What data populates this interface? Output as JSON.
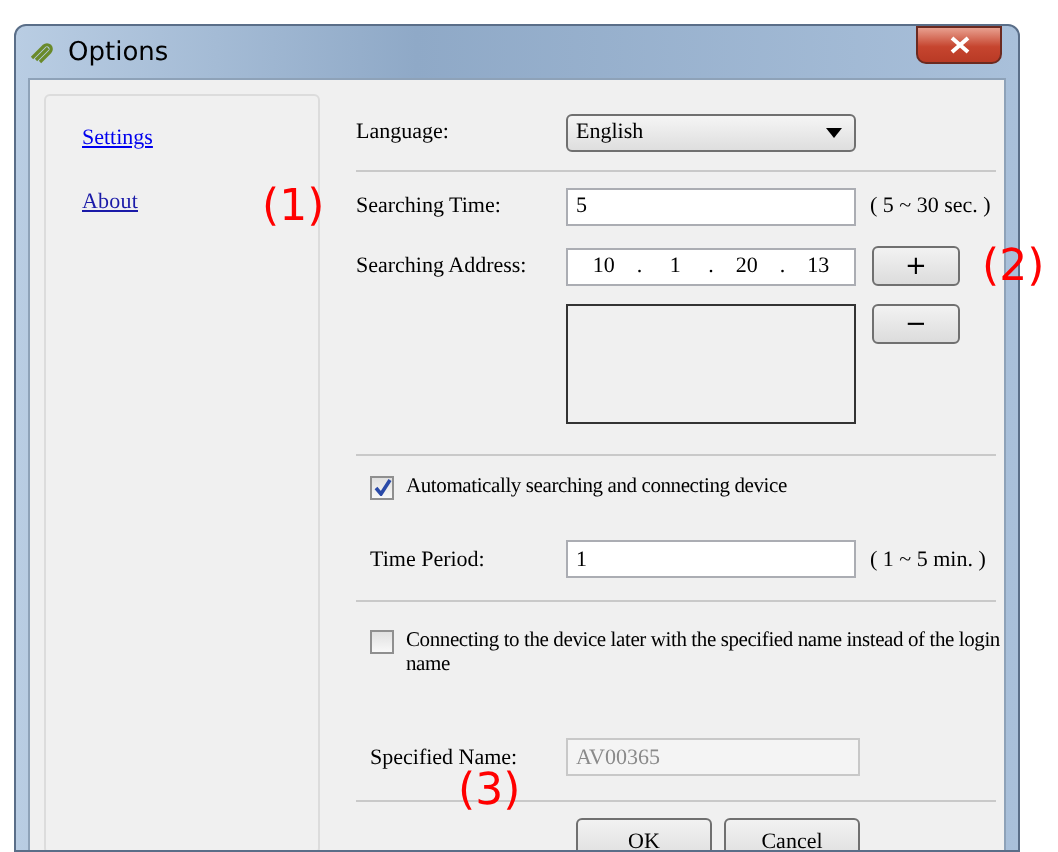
{
  "window": {
    "title": "Options"
  },
  "sidebar": {
    "items": [
      {
        "label": "Settings",
        "selected": true
      },
      {
        "label": "About",
        "selected": false
      }
    ]
  },
  "language": {
    "label": "Language:",
    "value": "English"
  },
  "searching_time": {
    "label": "Searching Time:",
    "value": "5",
    "hint": "( 5 ~ 30 sec. )"
  },
  "searching_address": {
    "label": "Searching Address:",
    "octets": [
      "10",
      "1",
      "20",
      "13"
    ],
    "separator": ".",
    "add_button": "+",
    "remove_button": "−"
  },
  "auto_search": {
    "label": "Automatically searching and connecting device",
    "checked": true
  },
  "time_period": {
    "label": "Time Period:",
    "value": "1",
    "hint": "( 1 ~ 5 min. )"
  },
  "specified_name_option": {
    "label": "Connecting to the device later with the specified name instead of the login name",
    "checked": false
  },
  "specified_name": {
    "label": "Specified Name:",
    "value": "AV00365",
    "disabled": true
  },
  "buttons": [
    "OK",
    "Cancel"
  ],
  "annotations": [
    "(1)",
    "(2)",
    "(3)"
  ]
}
